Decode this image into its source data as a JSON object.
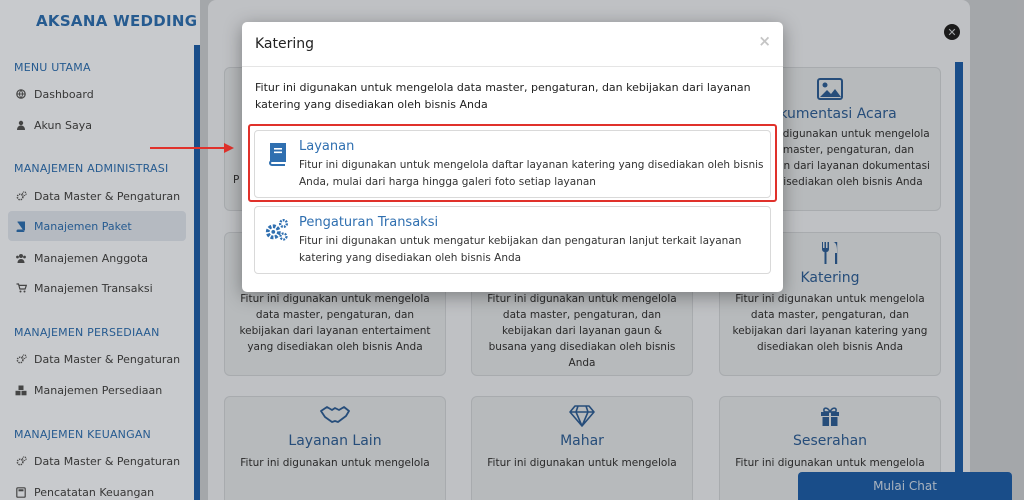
{
  "sidebar": {
    "brand": "AKSANA WEDDING",
    "sections": [
      {
        "title": "MENU UTAMA",
        "items": [
          {
            "label": "Dashboard",
            "icon": "globe-icon"
          },
          {
            "label": "Akun Saya",
            "icon": "user-icon"
          }
        ]
      },
      {
        "title": "MANAJEMEN ADMINISTRASI",
        "items": [
          {
            "label": "Data Master & Pengaturan",
            "icon": "cogs-icon"
          },
          {
            "label": "Manajemen Paket",
            "icon": "book-icon"
          },
          {
            "label": "Manajemen Anggota",
            "icon": "users-icon"
          },
          {
            "label": "Manajemen Transaksi",
            "icon": "cart-icon"
          }
        ]
      },
      {
        "title": "MANAJEMEN PERSEDIAAN",
        "items": [
          {
            "label": "Data Master & Pengaturan",
            "icon": "cogs-icon"
          },
          {
            "label": "Manajemen Persediaan",
            "icon": "cubes-icon"
          }
        ]
      },
      {
        "title": "MANAJEMEN KEUANGAN",
        "items": [
          {
            "label": "Data Master & Pengaturan",
            "icon": "cogs-icon"
          },
          {
            "label": "Pencatatan Keuangan",
            "icon": "calculator-icon"
          }
        ]
      }
    ]
  },
  "background_cards": {
    "dokumentasi": {
      "title": "Dokumentasi Acara",
      "title_visible": "kumentasi Acara",
      "desc": "Fitur ini digunakan untuk mengelola data master, pengaturan, dan kebijakan dari layanan dokumentasi yang disediakan oleh bisnis Anda",
      "partial_left": "P"
    },
    "entertaiment": {
      "desc": "Fitur ini digunakan untuk mengelola data master, pengaturan, dan kebijakan dari layanan entertaiment yang disediakan oleh bisnis Anda"
    },
    "gaun": {
      "desc": "Fitur ini digunakan untuk mengelola data master, pengaturan, dan kebijakan dari layanan gaun & busana yang disediakan oleh bisnis Anda"
    },
    "katering": {
      "title": "Katering",
      "desc": "Fitur ini digunakan untuk mengelola data master, pengaturan, dan kebijakan dari layanan katering yang disediakan oleh bisnis Anda"
    },
    "layanan_lain": {
      "title": "Layanan Lain",
      "desc": "Fitur ini digunakan untuk mengelola"
    },
    "mahar": {
      "title": "Mahar",
      "desc": "Fitur ini digunakan untuk mengelola"
    },
    "seserahan": {
      "title": "Seserahan",
      "desc": "Fitur ini digunakan untuk mengelola"
    }
  },
  "chat": {
    "label": "Mulai Chat"
  },
  "modal": {
    "title": "Katering",
    "close": "×",
    "description": "Fitur ini digunakan untuk mengelola data master, pengaturan, dan kebijakan dari layanan katering yang disediakan oleh bisnis Anda",
    "options": [
      {
        "title": "Layanan",
        "icon": "book-icon",
        "desc": "Fitur ini digunakan untuk mengelola daftar layanan katering yang disediakan oleh bisnis Anda, mulai dari harga hingga galeri foto setiap layanan"
      },
      {
        "title": "Pengaturan Transaksi",
        "icon": "cogs-icon",
        "desc": "Fitur ini digunakan untuk mengatur kebijakan dan pengaturan lanjut terkait layanan katering yang disediakan oleh bisnis Anda"
      }
    ]
  },
  "colors": {
    "accent": "#2f6fb0",
    "sidebar_bar": "#1f5fa8",
    "highlight": "#e0312b"
  }
}
